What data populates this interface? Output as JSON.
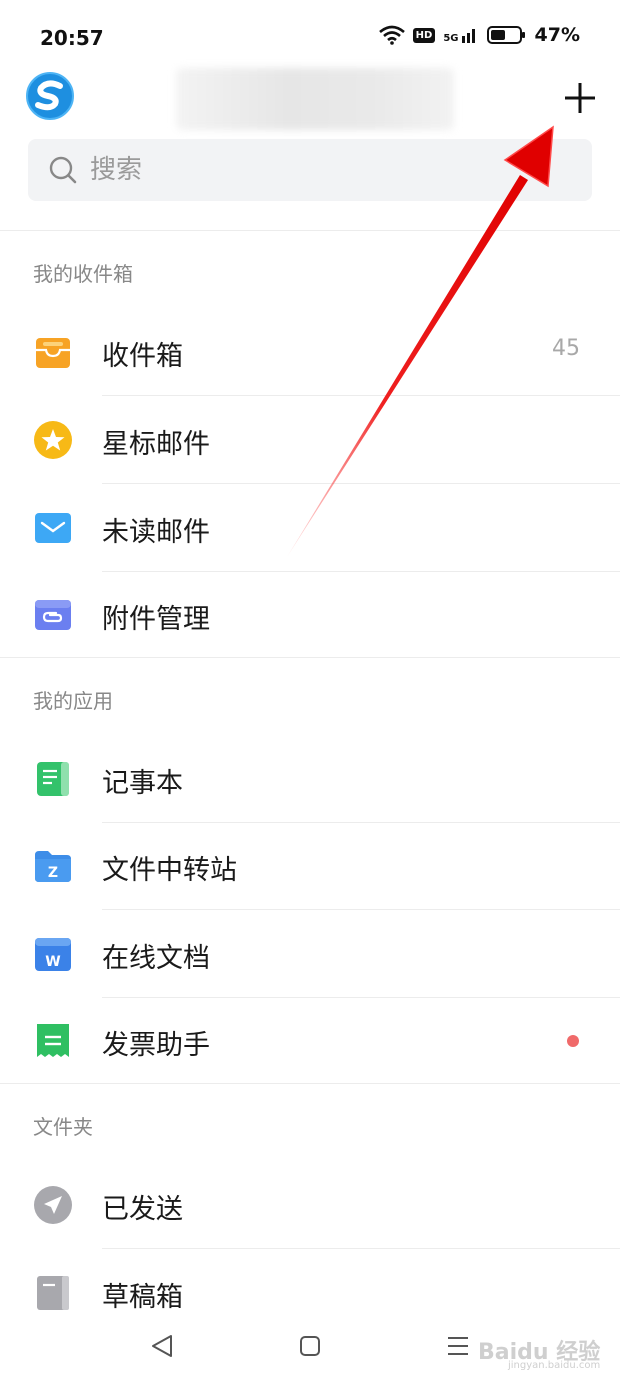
{
  "status_bar": {
    "time": "20:57",
    "network": "5G",
    "hd": "HD",
    "battery": "47%"
  },
  "header": {
    "plus_icon": "plus-icon",
    "logo_icon": "app-logo"
  },
  "search": {
    "placeholder": "搜索"
  },
  "mailbox_section": {
    "title": "我的收件箱",
    "items": [
      {
        "label": "收件箱",
        "icon": "inbox-icon",
        "color": "#f7a325",
        "count": "45"
      },
      {
        "label": "星标邮件",
        "icon": "star-icon",
        "color": "#f7b916"
      },
      {
        "label": "未读邮件",
        "icon": "unread-mail-icon",
        "color": "#3da8f5"
      },
      {
        "label": "附件管理",
        "icon": "attachment-icon",
        "color": "#6b7ff0"
      }
    ]
  },
  "apps_section": {
    "title": "我的应用",
    "items": [
      {
        "label": "记事本",
        "icon": "notepad-icon",
        "color": "#33c26b"
      },
      {
        "label": "文件中转站",
        "icon": "file-transfer-icon",
        "color": "#3d8de8"
      },
      {
        "label": "在线文档",
        "icon": "online-doc-icon",
        "color": "#3b82e8"
      },
      {
        "label": "发票助手",
        "icon": "invoice-icon",
        "color": "#2fbf62",
        "badge": "red-dot"
      }
    ]
  },
  "folders_section": {
    "title": "文件夹",
    "items": [
      {
        "label": "已发送",
        "icon": "sent-icon",
        "color": "#a8a8ad"
      },
      {
        "label": "草稿箱",
        "icon": "drafts-icon",
        "color": "#a8a8ad"
      }
    ]
  },
  "navbar": {
    "back": "back-icon",
    "home": "home-icon",
    "menu": "menu-icon"
  },
  "watermark": {
    "text": "Baidu 经验",
    "sub": "jingyan.baidu.com"
  }
}
